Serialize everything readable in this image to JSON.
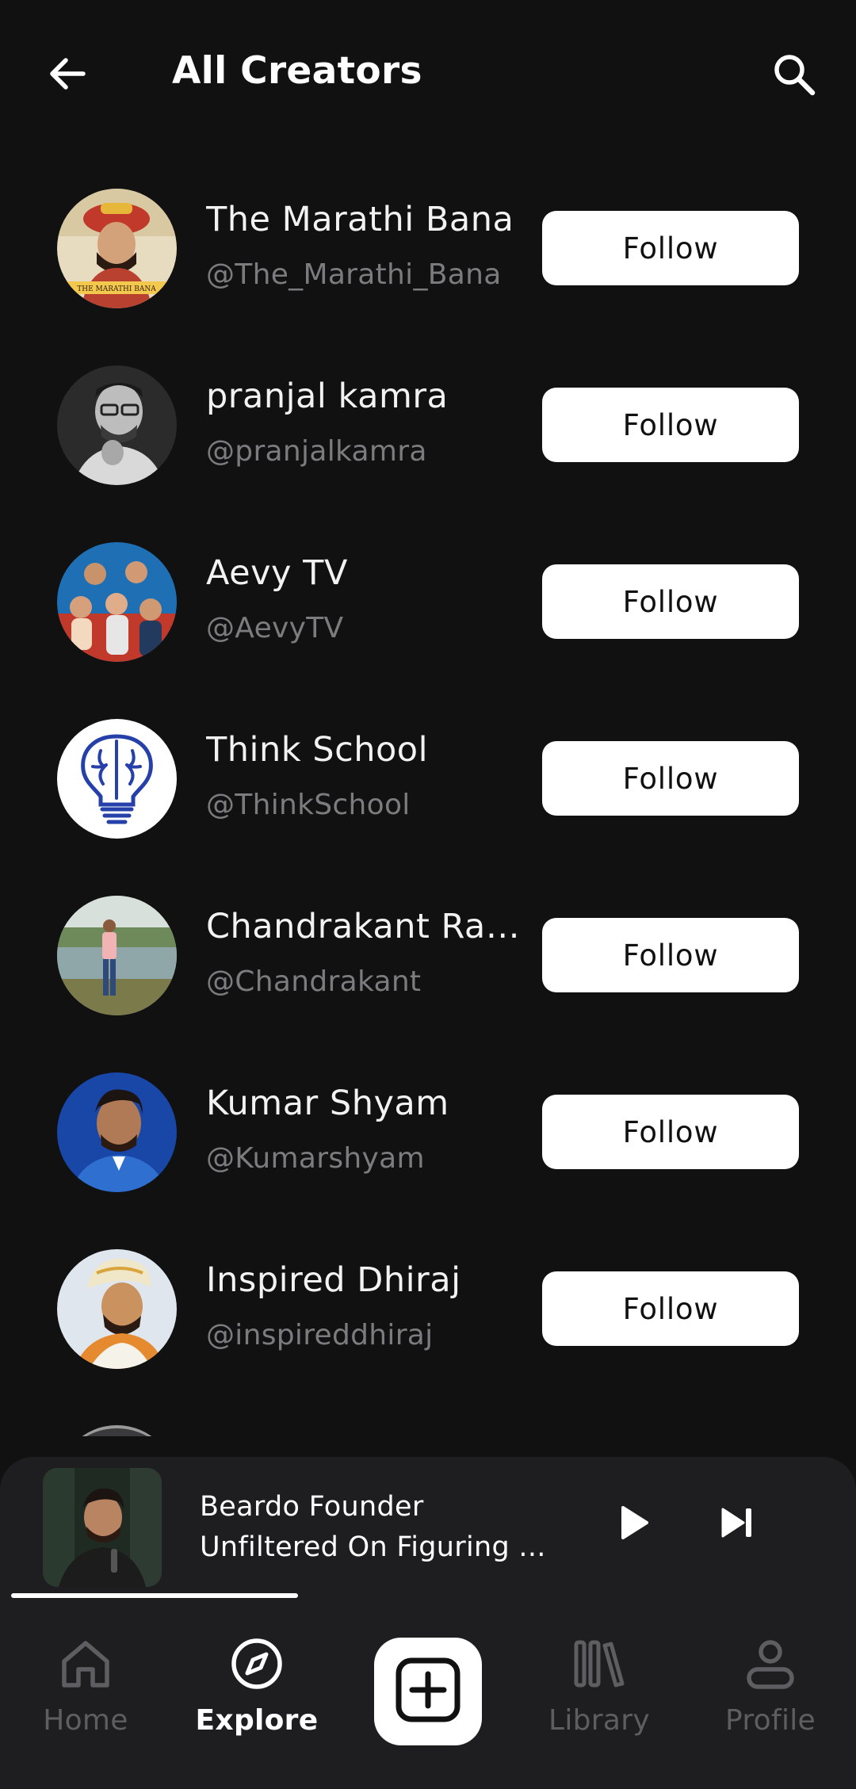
{
  "header": {
    "title": "All Creators",
    "back_icon": "arrow-left-icon",
    "search_icon": "search-icon"
  },
  "creators": [
    {
      "name": "The Marathi Bana",
      "handle": "@The_Marathi_Bana",
      "follow_label": "Follow",
      "avatar_logo_text": "THE MARATHI BANA"
    },
    {
      "name": "pranjal kamra",
      "handle": "@pranjalkamra",
      "follow_label": "Follow"
    },
    {
      "name": "Aevy TV",
      "handle": "@AevyTV",
      "follow_label": "Follow"
    },
    {
      "name": "Think School",
      "handle": "@ThinkSchool",
      "follow_label": "Follow"
    },
    {
      "name": "Chandrakant Raj...",
      "handle": "@Chandrakant",
      "follow_label": "Follow"
    },
    {
      "name": "Kumar Shyam",
      "handle": "@Kumarshyam",
      "follow_label": "Follow"
    },
    {
      "name": "Inspired Dhiraj",
      "handle": "@inspireddhiraj",
      "follow_label": "Follow"
    }
  ],
  "player": {
    "title_line1": "Beardo Founder",
    "title_line2": "Unfiltered On Figuring ...",
    "progress": 0.345,
    "play_icon": "play-icon",
    "next_icon": "skip-next-icon"
  },
  "nav": {
    "items": [
      {
        "label": "Home",
        "icon": "home-icon",
        "active": false
      },
      {
        "label": "Explore",
        "icon": "compass-icon",
        "active": true
      },
      {
        "label": "Library",
        "icon": "library-icon",
        "active": false
      },
      {
        "label": "Profile",
        "icon": "profile-icon",
        "active": false
      }
    ],
    "create_icon": "plus-square-icon"
  },
  "colors": {
    "background": "#111112",
    "surface": "#1e1e20",
    "primary_text": "#ffffff",
    "secondary_text": "#7c7c7e",
    "inactive_nav": "#5e5e62",
    "button_bg": "#ffffff"
  }
}
